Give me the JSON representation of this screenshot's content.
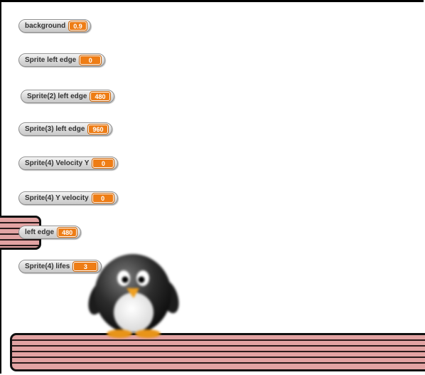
{
  "watchers": [
    {
      "name": "watcher-background",
      "label": "background",
      "value": "0.9"
    },
    {
      "name": "watcher-sprite-left-edge",
      "label": "Sprite left edge",
      "value": "0"
    },
    {
      "name": "watcher-sprite2-left-edge",
      "label": "Sprite(2) left edge",
      "value": "480"
    },
    {
      "name": "watcher-sprite3-left-edge",
      "label": "Sprite(3) left edge",
      "value": "960"
    },
    {
      "name": "watcher-sprite4-velocity-y",
      "label": "Sprite(4) Velocity Y",
      "value": "0"
    },
    {
      "name": "watcher-sprite4-y-velocity",
      "label": "Sprite(4) Y velocity",
      "value": "0"
    },
    {
      "name": "watcher-left-edge",
      "label": "left edge",
      "value": "480"
    },
    {
      "name": "watcher-sprite4-lifes",
      "label": "Sprite(4) lifes",
      "value": "3"
    }
  ],
  "colors": {
    "watcher_value_bg": "#ee7d16",
    "platform_fill": "#e2a3a3",
    "platform_outline": "#111111"
  },
  "sprites": {
    "player_icon": "penguin-icon",
    "platform_icon": "striped-platform"
  }
}
